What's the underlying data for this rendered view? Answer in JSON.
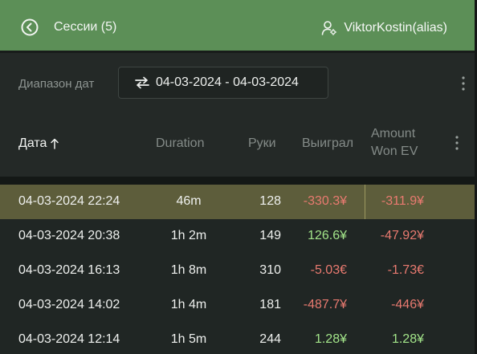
{
  "header": {
    "title": "Сессии (5)",
    "user": "ViktorKostin(alias)"
  },
  "filter": {
    "label": "Диапазон дат",
    "range": "04-03-2024 - 04-03-2024"
  },
  "table": {
    "columns": {
      "date": "Дата",
      "duration": "Duration",
      "hands": "Руки",
      "won": "Выиграл",
      "ev_line1": "Amount",
      "ev_line2": "Won EV"
    },
    "rows": [
      {
        "date": "04-03-2024 22:24",
        "duration": "46m",
        "hands": "128",
        "won": "-330.3¥",
        "ev": "-311.9¥",
        "won_sign": "neg",
        "ev_sign": "neg",
        "selected": true
      },
      {
        "date": "04-03-2024 20:38",
        "duration": "1h 2m",
        "hands": "149",
        "won": "126.6¥",
        "ev": "-47.92¥",
        "won_sign": "pos",
        "ev_sign": "neg",
        "selected": false
      },
      {
        "date": "04-03-2024 16:13",
        "duration": "1h 8m",
        "hands": "310",
        "won": "-5.03€",
        "ev": "-1.73€",
        "won_sign": "neg",
        "ev_sign": "neg",
        "selected": false
      },
      {
        "date": "04-03-2024 14:02",
        "duration": "1h 4m",
        "hands": "181",
        "won": "-487.7¥",
        "ev": "-446¥",
        "won_sign": "neg",
        "ev_sign": "neg",
        "selected": false
      },
      {
        "date": "04-03-2024 12:14",
        "duration": "1h 5m",
        "hands": "244",
        "won": "1.28¥",
        "ev": "1.28¥",
        "won_sign": "pos",
        "ev_sign": "pos",
        "selected": false
      }
    ]
  },
  "colors": {
    "header_bg": "#5c8f57",
    "selected_row": "#5d5d3b",
    "negative": "#e97a70",
    "positive": "#a3e58a"
  },
  "icons": {
    "back": "chevron-left-circle-icon",
    "user": "user-settings-icon",
    "range": "swap-arrows-icon",
    "sort": "arrow-up-icon",
    "more": "more-vertical-icon"
  }
}
